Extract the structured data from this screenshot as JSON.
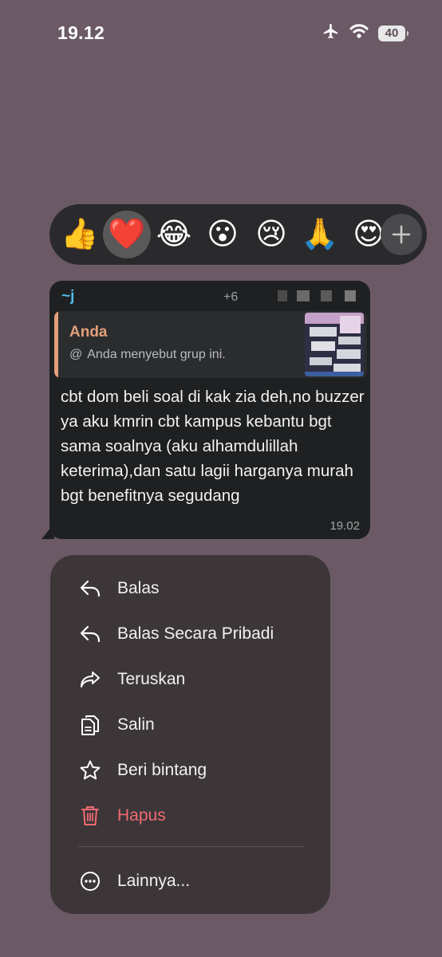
{
  "status_bar": {
    "time": "19.12",
    "airplane_icon": "airplane-icon",
    "wifi_icon": "wifi-icon",
    "battery_level": "40"
  },
  "reactions": [
    {
      "emoji": "👍",
      "name": "thumbs-up",
      "selected": false
    },
    {
      "emoji": "❤️",
      "name": "heart",
      "selected": true
    },
    {
      "emoji": "😂",
      "name": "tears-of-joy",
      "selected": false
    },
    {
      "emoji": "😮",
      "name": "surprised",
      "selected": false
    },
    {
      "emoji": "😢",
      "name": "crying",
      "selected": false
    },
    {
      "emoji": "🙏",
      "name": "folded-hands",
      "selected": false
    },
    {
      "emoji": "😍",
      "name": "heart-eyes",
      "selected": false
    }
  ],
  "message": {
    "sender": "~j",
    "sender_phone": "+6",
    "quote": {
      "author": "Anda",
      "text": "Anda menyebut grup ini."
    },
    "text": "cbt dom beli soal di kak zia deh,no buzzer ya aku kmrin cbt kampus kebantu bgt sama soalnya (aku alhamdulillah keterima),dan satu lagii harganya murah bgt benefitnya segudang",
    "time": "19.02"
  },
  "menu": {
    "items": [
      {
        "label": "Balas",
        "icon": "reply-icon"
      },
      {
        "label": "Balas Secara Pribadi",
        "icon": "reply-private-icon"
      },
      {
        "label": "Teruskan",
        "icon": "forward-icon"
      },
      {
        "label": "Salin",
        "icon": "copy-icon"
      },
      {
        "label": "Beri bintang",
        "icon": "star-icon"
      },
      {
        "label": "Hapus",
        "icon": "trash-icon"
      },
      {
        "label": "Lainnya...",
        "icon": "more-icon"
      }
    ]
  },
  "colors": {
    "background": "#6b5a66",
    "sender": "#53bdeb",
    "quote_author": "#e39f7a",
    "destructive": "#f06b72"
  }
}
